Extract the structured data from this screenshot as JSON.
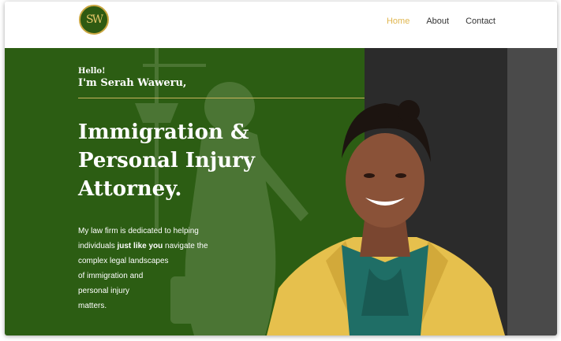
{
  "header": {
    "logo_text": "SW",
    "nav": [
      {
        "label": "Home",
        "active": true
      },
      {
        "label": "About",
        "active": false
      },
      {
        "label": "Contact",
        "active": false
      }
    ]
  },
  "hero": {
    "greeting": "Hello!",
    "name": "I'm Serah Waweru,",
    "title_lines": [
      "Immigration &",
      "Personal Injury",
      "Attorney."
    ],
    "description": {
      "line1": "My law firm is dedicated to helping",
      "line2_pre": "individuals ",
      "line2_bold": "just like you",
      "line2_post": " navigate the",
      "line3": "complex legal landscapes",
      "line4": "of immigration and",
      "line5": "personal injury",
      "line6": "matters."
    }
  },
  "colors": {
    "accent_gold": "#e0b64f",
    "hero_green": "#2c5d13",
    "panel_dark": "#2b2b2b",
    "panel_gray": "#4a4a4a"
  }
}
